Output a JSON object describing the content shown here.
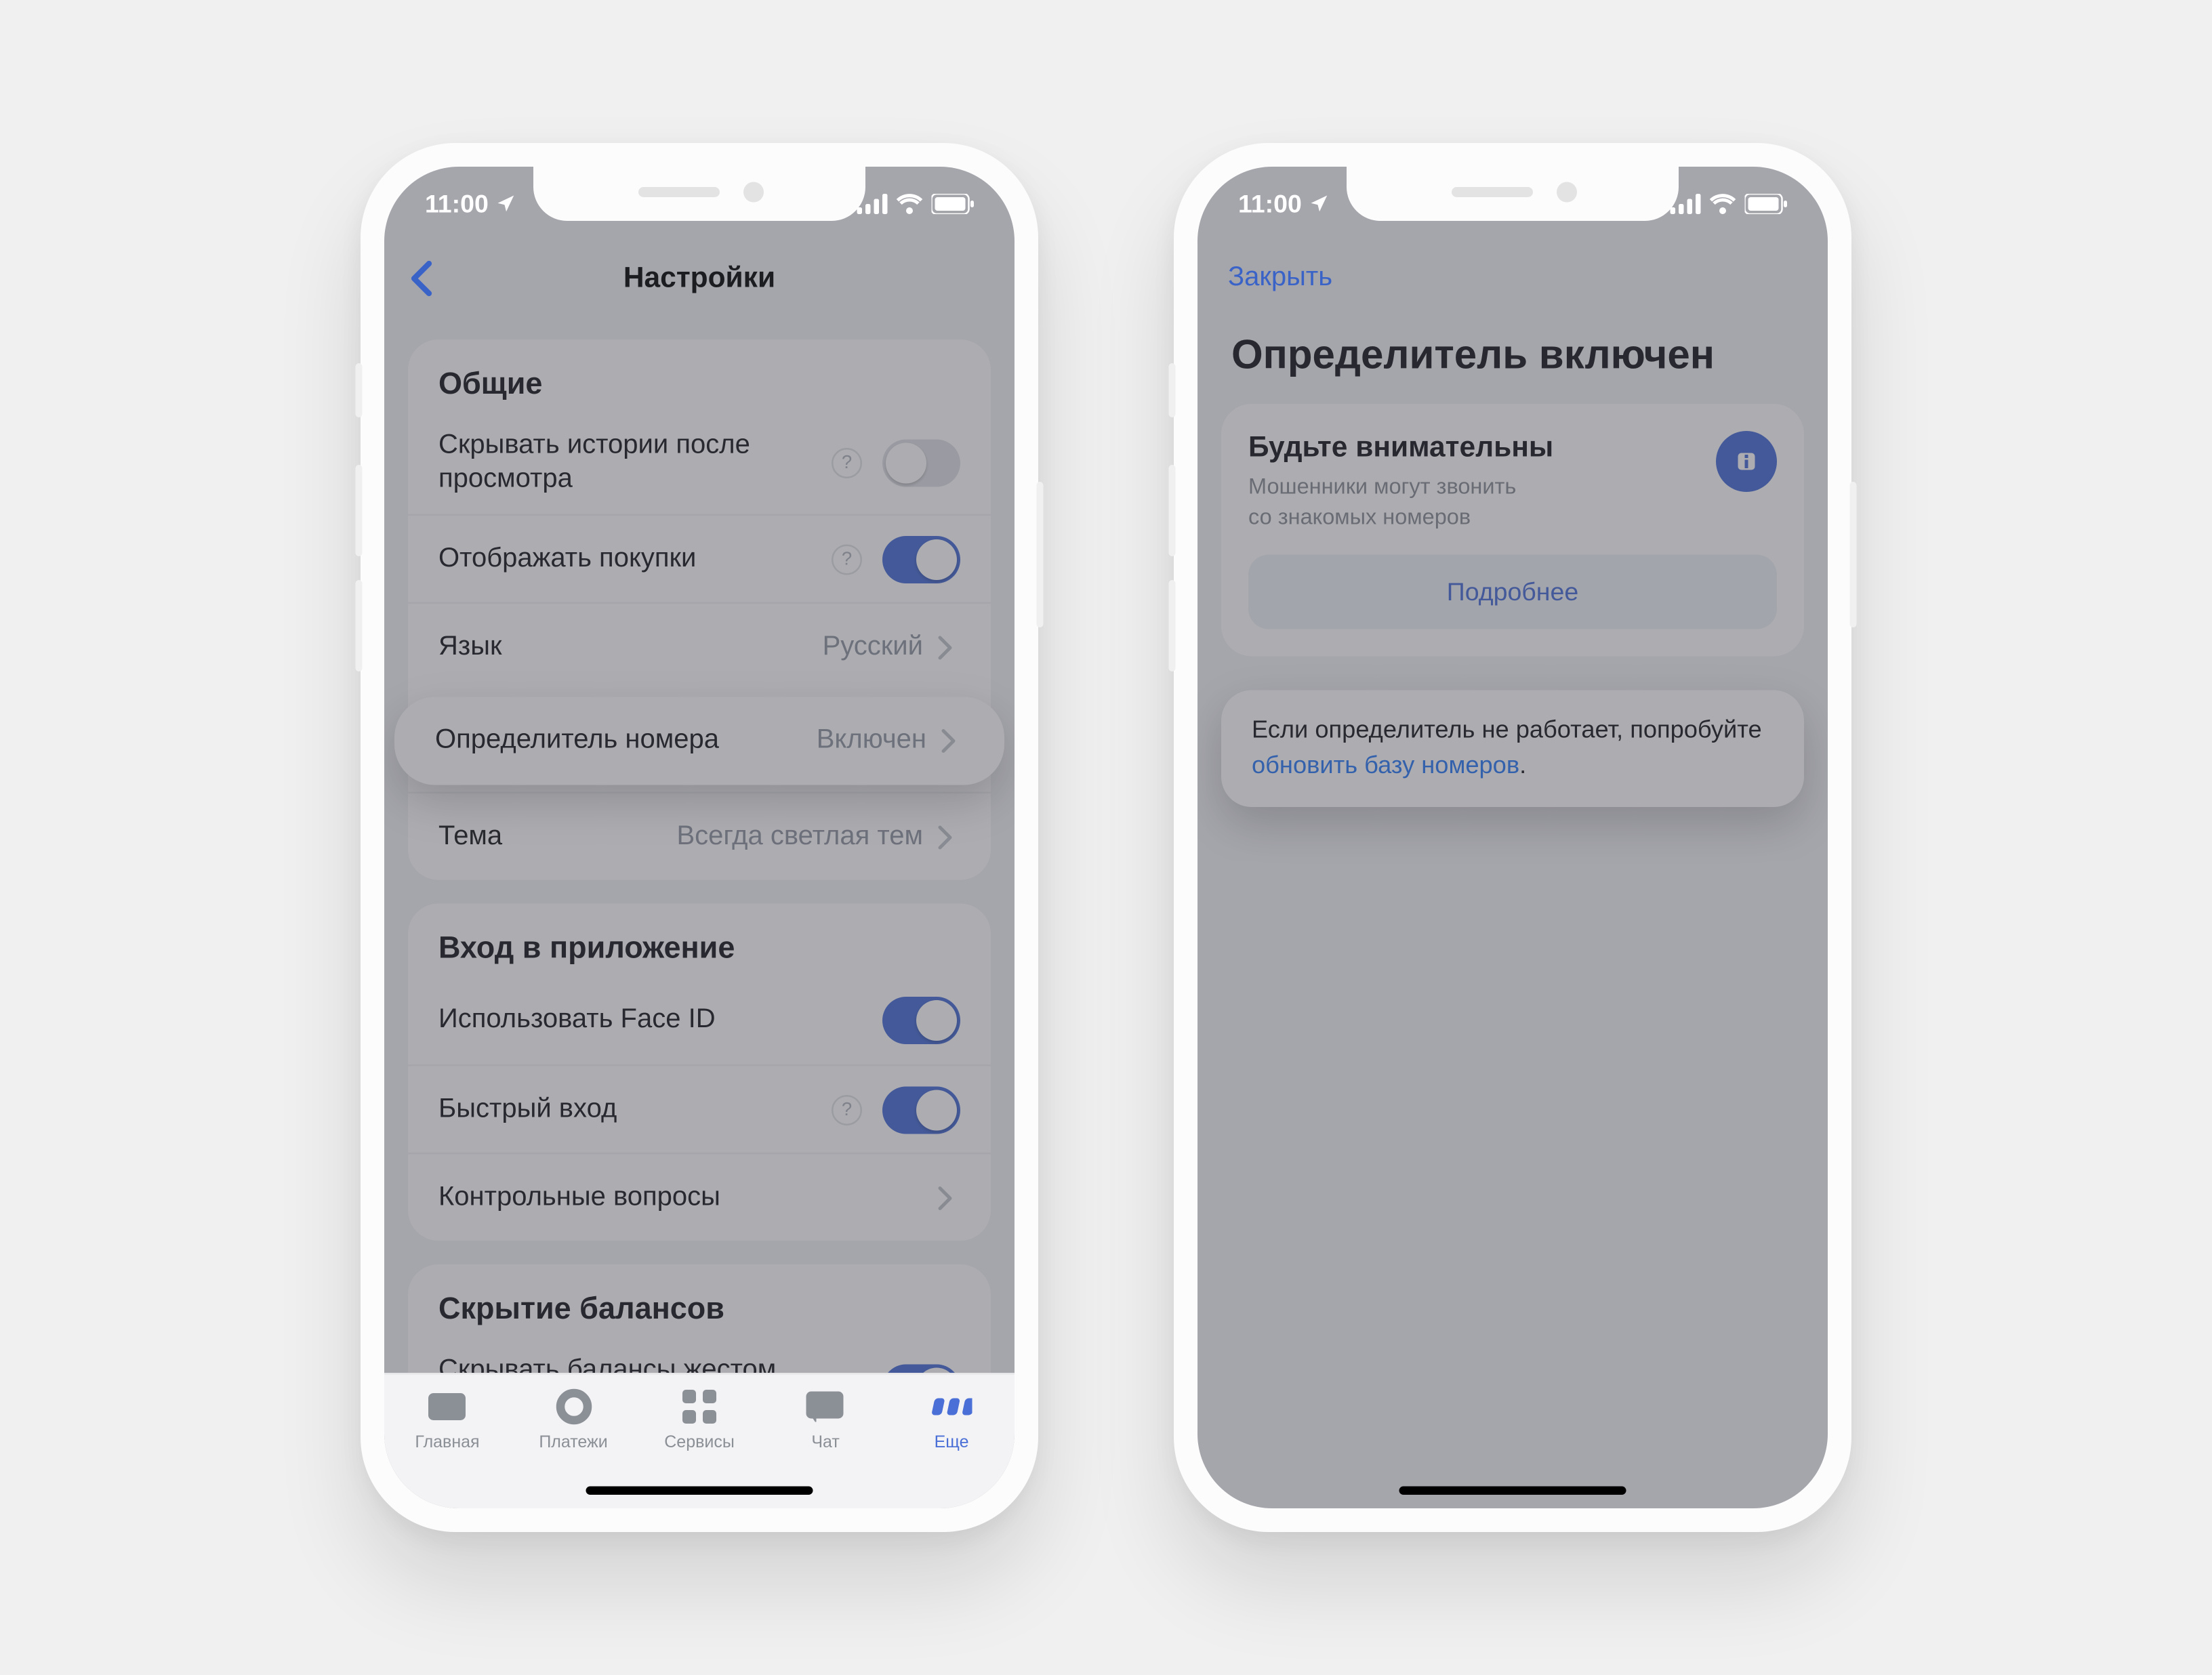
{
  "status": {
    "time": "11:00"
  },
  "phone1": {
    "nav_title": "Настройки",
    "sections": {
      "general": {
        "title": "Общие",
        "hide_stories": "Скрывать истории после просмотра",
        "show_purchases": "Отображать покупки",
        "language_label": "Язык",
        "language_value": "Русский",
        "caller_id_label": "Определитель номера",
        "caller_id_value": "Включен",
        "theme_label": "Тема",
        "theme_value": "Всегда светлая тем"
      },
      "login": {
        "title": "Вход в приложение",
        "faceid": "Использовать Face ID",
        "quick_login": "Быстрый вход",
        "security_questions": "Контрольные вопросы"
      },
      "hide_balances": {
        "title": "Скрытие балансов",
        "shake": "Скрывать балансы жестом переворота"
      }
    },
    "tabs": {
      "home": "Главная",
      "payments": "Платежи",
      "services": "Сервисы",
      "chat": "Чат",
      "more": "Еще"
    }
  },
  "phone2": {
    "close": "Закрыть",
    "title": "Определитель включен",
    "alert_title": "Будьте внимательны",
    "alert_desc1": "Мошенники могут звонить",
    "alert_desc2": "со знакомых номеров",
    "more_btn": "Подробнее",
    "hint_text_1": "Если определитель не работает, попробуйте ",
    "hint_link": "обновить базу номеров",
    "hint_text_2": "."
  }
}
